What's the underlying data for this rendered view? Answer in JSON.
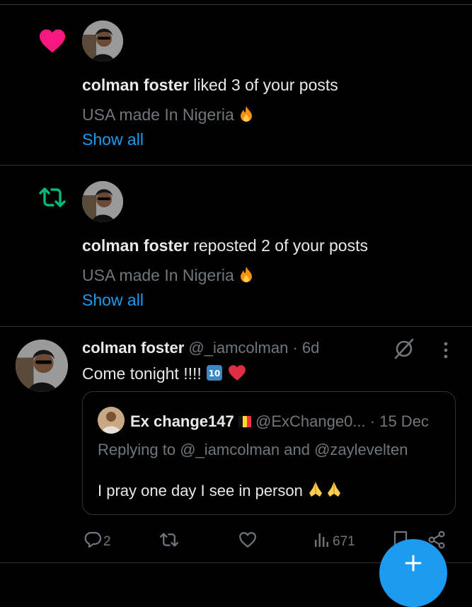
{
  "notifications": [
    {
      "type": "like",
      "user": "colman foster",
      "action_text": "liked 3 of your posts",
      "post_preview": "USA made In Nigeria",
      "show_all": "Show all"
    },
    {
      "type": "repost",
      "user": "colman foster",
      "action_text": "reposted 2 of your posts",
      "post_preview": "USA made In Nigeria",
      "show_all": "Show all"
    }
  ],
  "tweet": {
    "name": "colman foster",
    "handle": "@_iamcolman",
    "time": "· 6d",
    "text": "Come tonight !!!!",
    "quote": {
      "name": "Ex change147",
      "handle": "@ExChange0...",
      "time": "· 15 Dec",
      "replying_prefix": "Replying to",
      "replying_users": "@_iamcolman and @zaylevelten",
      "text": "I pray one day I see in person"
    },
    "stats": {
      "replies": "2",
      "reposts": "",
      "likes": "",
      "views": "671"
    }
  },
  "colors": {
    "background": "#000000",
    "like_pink": "#f91880",
    "repost_green": "#00ba7c",
    "link_blue": "#1d9bf0",
    "muted_gray": "#71767b"
  },
  "icons": [
    "heart-icon",
    "repost-icon",
    "grok-icon",
    "more-icon",
    "reply-icon",
    "like-icon",
    "views-icon",
    "bookmark-icon",
    "share-icon",
    "fire-emoji",
    "keycap-ten-emoji",
    "red-heart-emoji",
    "pray-emoji",
    "belgium-flag"
  ]
}
